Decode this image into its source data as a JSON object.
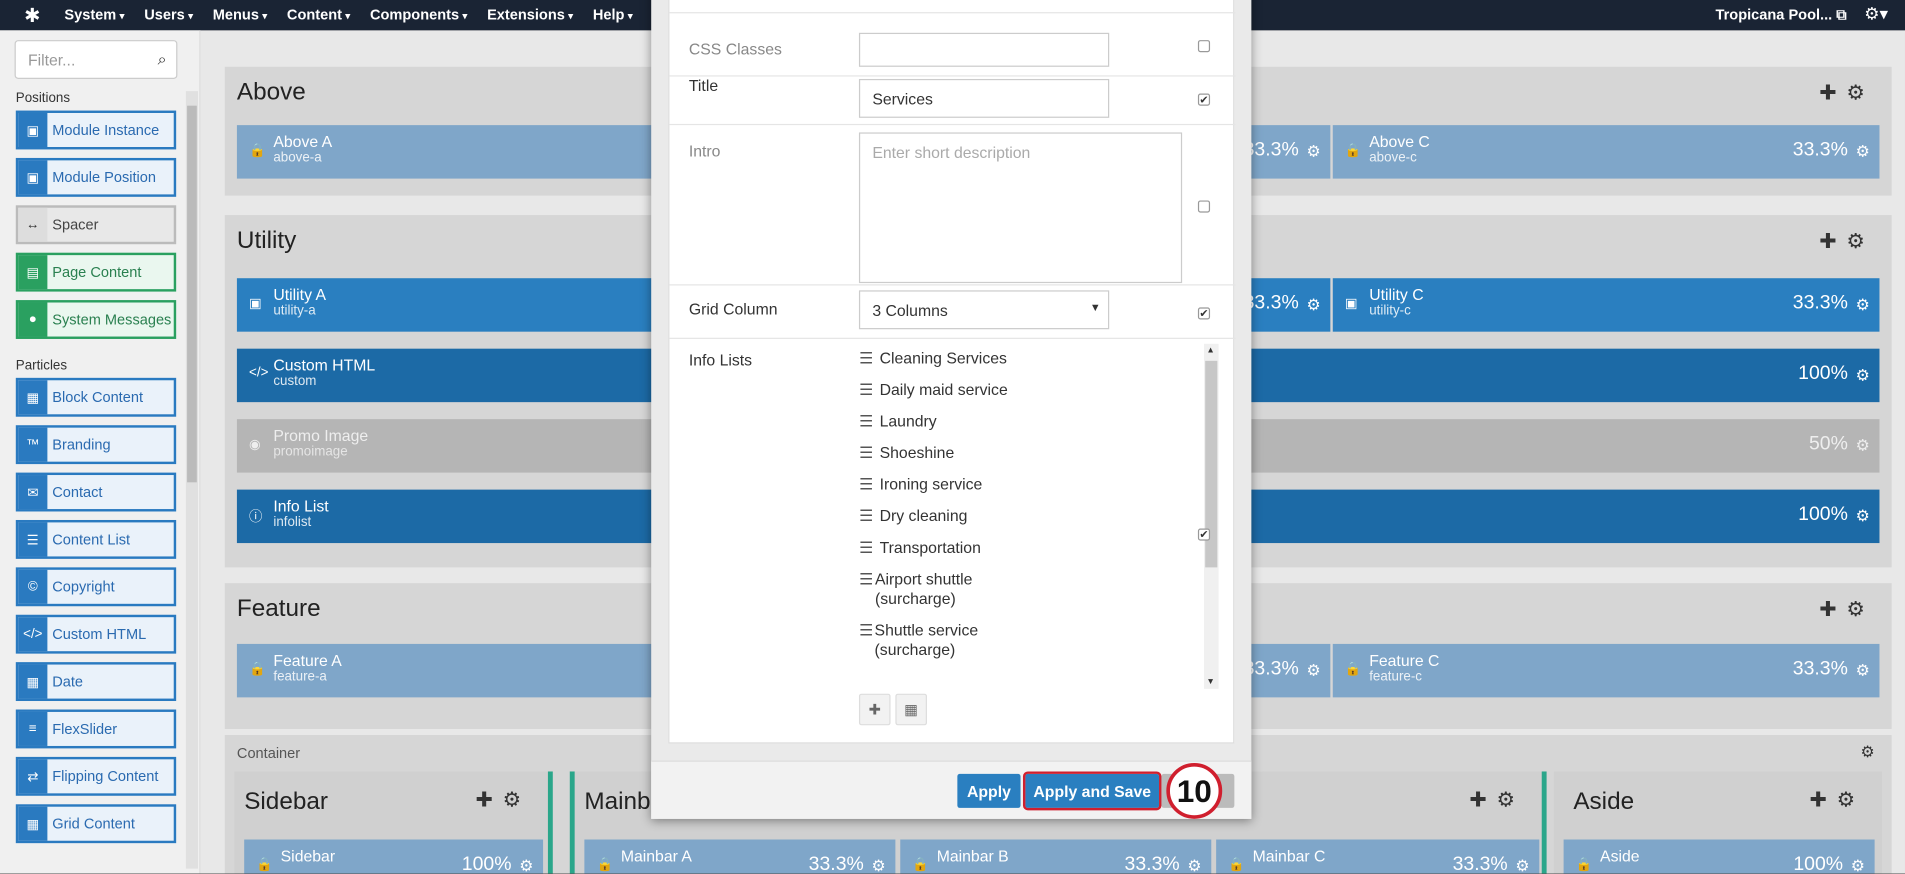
{
  "topbar": {
    "menu": [
      "System",
      "Users",
      "Menus",
      "Content",
      "Components",
      "Extensions",
      "Help"
    ],
    "site": "Tropicana Pool..."
  },
  "sidebar": {
    "filter_placeholder": "Filter...",
    "positions_label": "Positions",
    "particles_label": "Particles",
    "positions": [
      "Module Instance",
      "Module Position",
      "Spacer",
      "Page Content",
      "System Messages"
    ],
    "particles": [
      "Block Content",
      "Branding",
      "Contact",
      "Content List",
      "Copyright",
      "Custom HTML",
      "Date",
      "FlexSlider",
      "Flipping Content",
      "Grid Content"
    ]
  },
  "layout": {
    "above": {
      "title": "Above",
      "a": "Above A",
      "a_id": "above-a",
      "c": "Above C",
      "c_id": "above-c",
      "pct": "33.3%"
    },
    "utility": {
      "title": "Utility",
      "a": "Utility A",
      "a_id": "utility-a",
      "c": "Utility C",
      "c_id": "utility-c",
      "pct": "33.3%"
    },
    "custom": {
      "name": "Custom HTML",
      "id": "custom",
      "pct": "100%"
    },
    "promo": {
      "name": "Promo Image",
      "id": "promoimage",
      "pct": "50%"
    },
    "infolist": {
      "name": "Info List",
      "id": "infolist",
      "pct": "100%"
    },
    "feature": {
      "title": "Feature",
      "a": "Feature A",
      "a_id": "feature-a",
      "c": "Feature C",
      "c_id": "feature-c",
      "pct": "33.3%"
    },
    "container": {
      "title": "Container"
    },
    "sidebar_sec": {
      "title": "Sidebar",
      "block": "Sidebar",
      "pct": "100%"
    },
    "mainbar": {
      "title": "Mainb",
      "a": "Mainbar A",
      "b": "Mainbar B",
      "c": "Mainbar C",
      "pct": "33.3%"
    },
    "aside": {
      "title": "Aside",
      "block": "Aside",
      "pct": "100%"
    }
  },
  "modal": {
    "css_classes_label": "CSS Classes",
    "title_label": "Title",
    "title_value": "Services",
    "intro_label": "Intro",
    "intro_placeholder": "Enter short description",
    "grid_label": "Grid Column",
    "grid_value": "3 Columns",
    "info_lists_label": "Info Lists",
    "info_items": [
      "Cleaning Services",
      "Daily maid service",
      "Laundry",
      "Shoeshine",
      "Ironing service",
      "Dry cleaning",
      "Transportation",
      "Airport shuttle (surcharge)",
      "Shuttle service (surcharge)"
    ],
    "apply_label": "Apply",
    "apply_save_label": "Apply and Save",
    "step_number": "10"
  }
}
